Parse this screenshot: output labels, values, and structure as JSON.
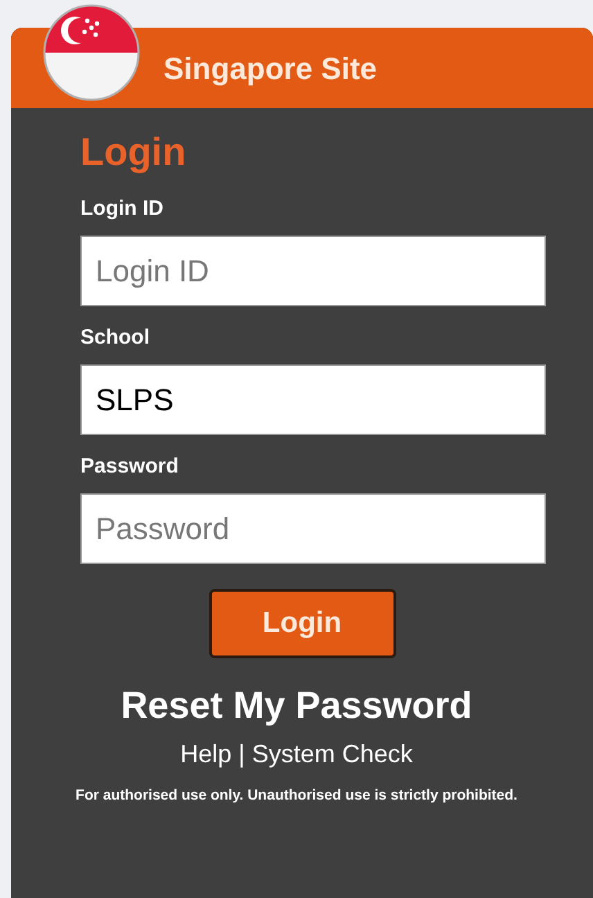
{
  "header": {
    "title": "Singapore Site"
  },
  "form": {
    "heading": "Login",
    "fields": [
      {
        "label": "Login ID",
        "placeholder": "Login ID",
        "kind": "text"
      },
      {
        "label": "School",
        "value": "SLPS",
        "kind": "text"
      },
      {
        "label": "Password",
        "placeholder": "Password",
        "kind": "password"
      }
    ],
    "submit": "Login"
  },
  "reset_link": "Reset My Password",
  "links": [
    "Help",
    "System Check"
  ],
  "separator": "|",
  "disclaimer": "For authorised use only. Unauthorised use is strictly prohibited."
}
